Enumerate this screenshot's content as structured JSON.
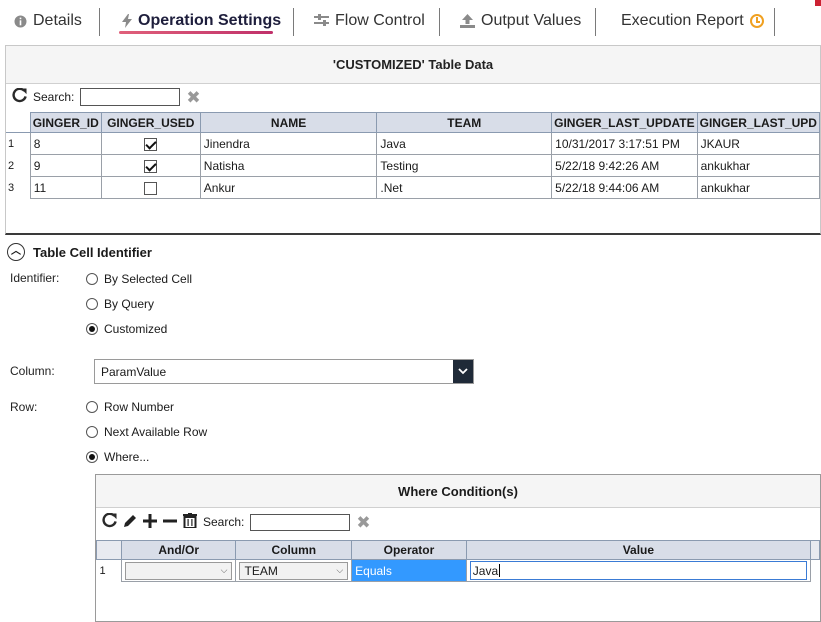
{
  "tabs": [
    {
      "label": "Details",
      "icon": "info-icon"
    },
    {
      "label": "Operation Settings",
      "icon": "lightning-icon",
      "active": true
    },
    {
      "label": "Flow Control",
      "icon": "flow-control-icon"
    },
    {
      "label": "Output Values",
      "icon": "upload-icon"
    },
    {
      "label": "Execution Report",
      "icon": "clock-icon"
    }
  ],
  "table_panel": {
    "title": "'CUSTOMIZED' Table Data",
    "search_label": "Search:",
    "search_value": "",
    "columns": [
      "GINGER_ID",
      "GINGER_USED",
      "NAME",
      "TEAM",
      "GINGER_LAST_UPDATE",
      "GINGER_LAST_UPD"
    ],
    "rows": [
      {
        "num": "1",
        "id": "8",
        "used": true,
        "name": "Jinendra",
        "team": "Java",
        "updated": "10/31/2017 3:17:51 PM",
        "by": "JKAUR"
      },
      {
        "num": "2",
        "id": "9",
        "used": true,
        "name": "Natisha",
        "team": "Testing",
        "updated": "5/22/18 9:42:26 AM",
        "by": "ankukhar"
      },
      {
        "num": "3",
        "id": "11",
        "used": false,
        "name": "Ankur",
        "team": ".Net",
        "updated": "5/22/18 9:44:06 AM",
        "by": "ankukhar"
      }
    ]
  },
  "identifier_section": {
    "title": "Table Cell Identifier",
    "identifier_label": "Identifier:",
    "identifier_options": [
      "By Selected Cell",
      "By Query",
      "Customized"
    ],
    "identifier_selected": "Customized",
    "column_label": "Column:",
    "column_value": "ParamValue",
    "row_label": "Row:",
    "row_options": [
      "Row Number",
      "Next Available Row",
      "Where..."
    ],
    "row_selected": "Where..."
  },
  "where_panel": {
    "title": "Where Condition(s)",
    "search_label": "Search:",
    "search_value": "",
    "columns": [
      "And/Or",
      "Column",
      "Operator",
      "Value"
    ],
    "rows": [
      {
        "num": "1",
        "and_or": "",
        "column": "TEAM",
        "operator": "Equals",
        "value": "Java"
      }
    ]
  },
  "colors": {
    "accent_underline": "#d04070",
    "header_bg": "#d8dde8",
    "selection": "#3399ff",
    "dropdown_btn": "#1f2a38"
  }
}
